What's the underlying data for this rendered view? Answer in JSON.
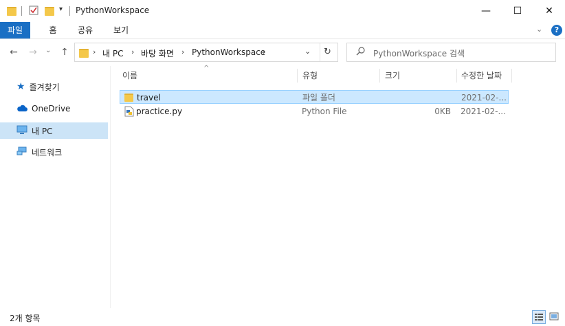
{
  "window": {
    "title": "PythonWorkspace",
    "minimize": "—",
    "maximize": "☐",
    "close": "✕"
  },
  "ribbon": {
    "tabs": [
      {
        "label": "파일"
      },
      {
        "label": "홈"
      },
      {
        "label": "공유"
      },
      {
        "label": "보기"
      }
    ]
  },
  "address": {
    "crumbs": [
      "내 PC",
      "바탕 화면",
      "PythonWorkspace"
    ],
    "search_placeholder": "PythonWorkspace 검색"
  },
  "nav": {
    "items": [
      {
        "label": "즐겨찾기",
        "icon": "star-icon"
      },
      {
        "label": "OneDrive",
        "icon": "cloud-icon"
      },
      {
        "label": "내 PC",
        "icon": "computer-icon",
        "selected": true
      },
      {
        "label": "네트워크",
        "icon": "network-icon"
      }
    ]
  },
  "columns": {
    "name": "이름",
    "type": "유형",
    "size": "크기",
    "modified": "수정한 날짜"
  },
  "files": [
    {
      "name": "travel",
      "type": "파일 폴더",
      "size": "",
      "modified": "2021-02-...",
      "icon": "folder-icon",
      "selected": true
    },
    {
      "name": "practice.py",
      "type": "Python File",
      "size": "0KB",
      "modified": "2021-02-...",
      "icon": "python-file-icon",
      "selected": false
    }
  ],
  "status": {
    "count": "2개 항목"
  },
  "colors": {
    "accent": "#1a6fc4",
    "selection": "#cce8ff",
    "folder": "#f4c84a"
  }
}
